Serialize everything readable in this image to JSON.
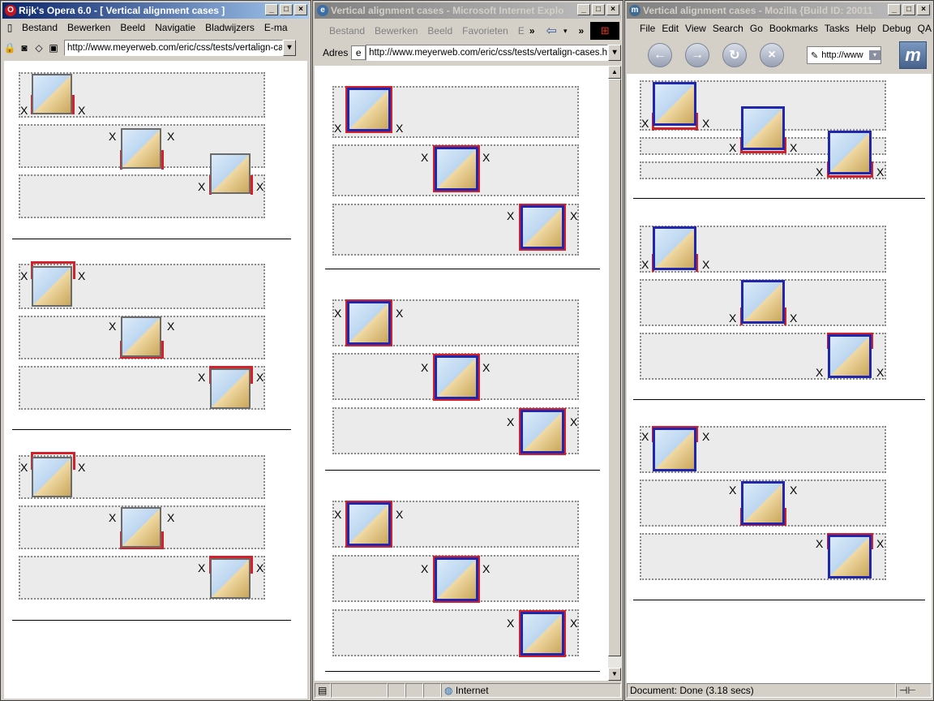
{
  "opera": {
    "title": "Rijk's Opera 6.0 - [ Vertical alignment cases ]",
    "menu": [
      "Bestand",
      "Bewerken",
      "Beeld",
      "Navigatie",
      "Bladwijzers",
      "E-ma"
    ],
    "url": "http://www.meyerweb.com/eric/css/tests/vertalign-cas",
    "x_mark": "X"
  },
  "ie": {
    "title": "Vertical alignment cases - Microsoft Internet Explor",
    "menu": [
      "Bestand",
      "Bewerken",
      "Beeld",
      "Favorieten",
      "E"
    ],
    "address_label": "Adres",
    "url": "http://www.meyerweb.com/eric/css/tests/vertalign-cases.ht",
    "status_zone": "Internet",
    "x_mark": "X"
  },
  "mozilla": {
    "title": "Vertical alignment cases - Mozilla {Build ID: 20011",
    "menu": [
      "File",
      "Edit",
      "View",
      "Search",
      "Go",
      "Bookmarks",
      "Tasks",
      "Help",
      "Debug",
      "QA"
    ],
    "url": "http://www",
    "status": "Document: Done (3.18 secs)",
    "x_mark": "X"
  },
  "icons": [
    "opera-logo-icon",
    "ie-page-icon",
    "mozilla-logo-icon",
    "back-icon",
    "forward-icon",
    "reload-icon",
    "stop-icon",
    "windows-logo-icon",
    "globe-icon"
  ]
}
